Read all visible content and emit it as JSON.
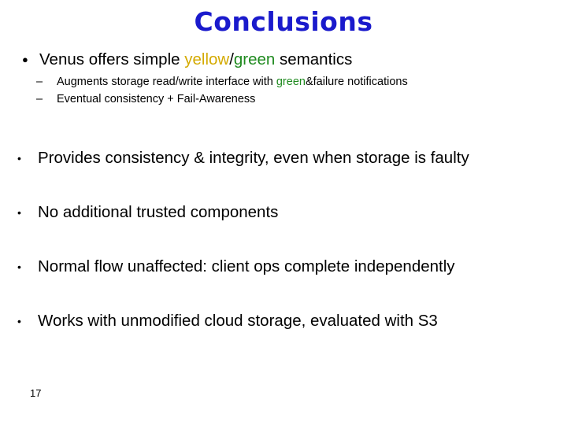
{
  "slide": {
    "title": "Conclusions",
    "title_color": "#1a1acc",
    "background_color": "#ffffff",
    "text_color": "#000000",
    "number": "17"
  },
  "accents": {
    "yellow": "#d4aa00",
    "green": "#1f8a1f"
  },
  "markers": {
    "round_dot": "●",
    "small_dot": "•",
    "dash": "–"
  },
  "content": {
    "lead_bullet": {
      "part1": "Venus offers simple ",
      "kw_yellow": "yellow",
      "slash": "/",
      "kw_green": "green",
      "part2": " semantics"
    },
    "sub_bullets": [
      {
        "part1": "Augments storage read/write interface with ",
        "kw_green": "green",
        "part2": "&failure notifications"
      },
      {
        "part1": "Eventual consistency + Fail-Awareness",
        "kw_green": "",
        "part2": ""
      }
    ],
    "main_bullets": [
      {
        "text": "Provides consistency & integrity, even when storage is faulty"
      },
      {
        "text": "No additional trusted components"
      },
      {
        "text": "Normal flow unaffected: client ops complete independently"
      },
      {
        "text": "Works with unmodified cloud storage, evaluated with S3"
      }
    ]
  }
}
